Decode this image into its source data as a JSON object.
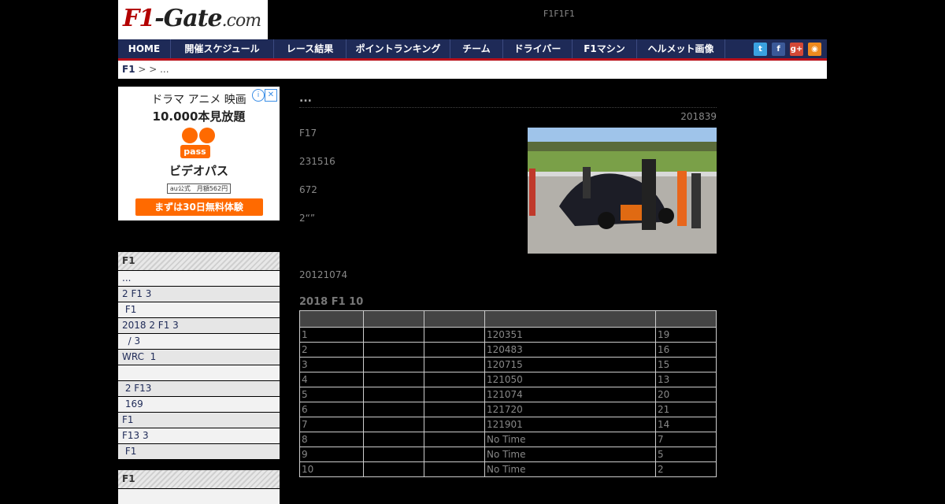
{
  "site": {
    "logo": {
      "f1": "F1",
      "rest": "-Gate",
      "dom": ".com"
    },
    "header_note": "F1F1F1"
  },
  "nav": {
    "items": [
      "HOME",
      "開催スケジュール",
      "レース結果",
      "ポイントランキング",
      "チーム",
      "ドライバー",
      "F1マシン",
      "ヘルメット画像"
    ],
    "social": [
      "twitter-icon",
      "facebook-icon",
      "googleplus-icon",
      "rss-icon"
    ],
    "colors": {
      "bar": "#1e2a57",
      "accent": "#b9101a"
    }
  },
  "breadcrumb": {
    "root": "F1",
    "rest": " >  > ..."
  },
  "ad": {
    "line1": "ドラマ アニメ 映画",
    "line2": "10.000本見放題",
    "brand": "pass",
    "name": "ビデオパス",
    "badge": "au公式　月額562円",
    "cta": "まずは30日無料体験",
    "info": "i",
    "close": "✕"
  },
  "sidebar": {
    "box1": {
      "title": "F1",
      "items": [
        "...",
        "2 F1 3",
        " F1",
        "2018 2 F1 3",
        "  / 3",
        "WRC  1",
        "",
        " 2 F13",
        " 169",
        "F1",
        "F13 3",
        " F1"
      ]
    },
    "box2": {
      "title": "F1"
    }
  },
  "article": {
    "title": "...",
    "date": "201839",
    "paragraphs": [
      "F17",
      "231516",
      "672",
      "2“”",
      "20121074"
    ],
    "subhead": "2018 F1  10",
    "table": {
      "rows": [
        [
          "1",
          "",
          "",
          "120351",
          "19"
        ],
        [
          "2",
          "",
          "",
          "120483",
          "16"
        ],
        [
          "3",
          "",
          "",
          "120715",
          "15"
        ],
        [
          "4",
          "",
          "",
          "121050",
          "13"
        ],
        [
          "5",
          "",
          "",
          "121074",
          "20"
        ],
        [
          "6",
          "",
          "",
          "121720",
          "21"
        ],
        [
          "7",
          "",
          "",
          "121901",
          "14"
        ],
        [
          "8",
          "",
          "",
          "No Time",
          "7"
        ],
        [
          "9",
          "",
          "",
          "No Time",
          "5"
        ],
        [
          "10",
          "",
          "",
          "No Time",
          "2"
        ]
      ]
    }
  }
}
